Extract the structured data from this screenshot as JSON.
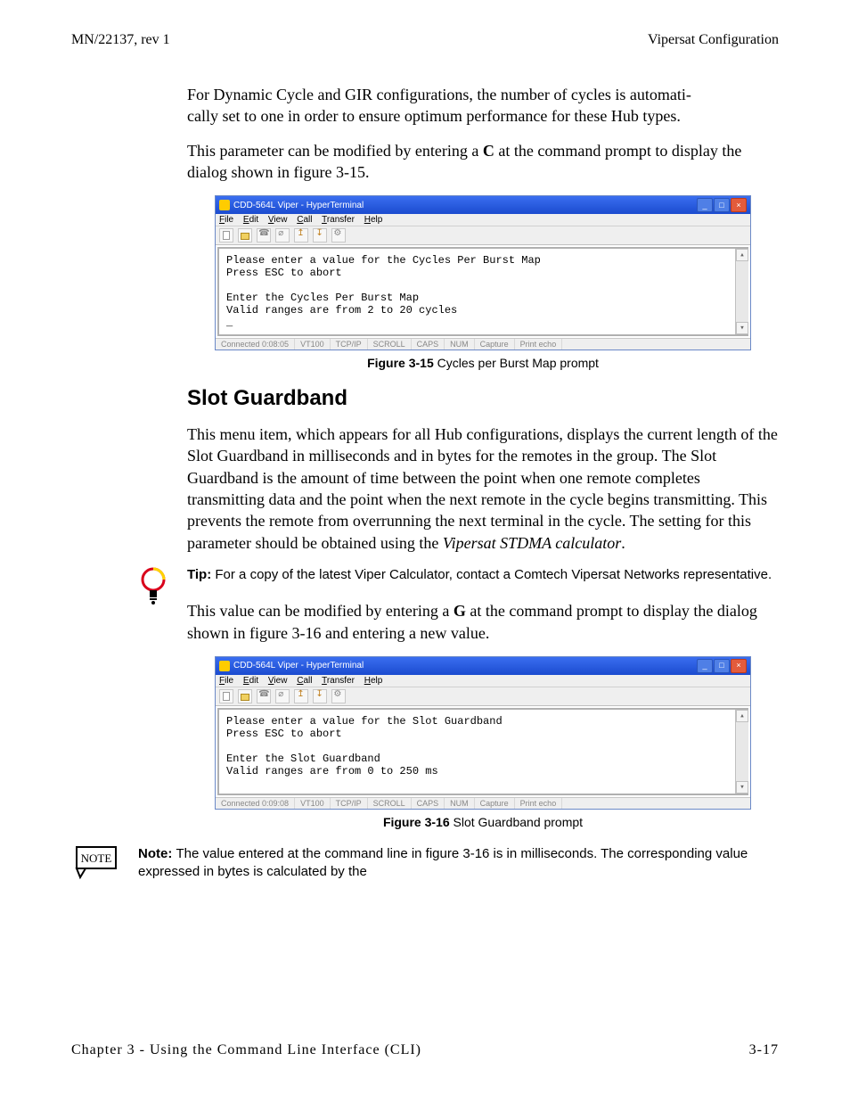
{
  "header": {
    "left": "MN/22137, rev 1",
    "right": "Vipersat Configuration"
  },
  "para1_a": "For Dynamic Cycle and GIR configurations, the number of cycles is automati-",
  "para1_b": "cally set to one in order to ensure optimum performance for these Hub types.",
  "para2_a": "This parameter can be modified by entering a ",
  "para2_bold": "C",
  "para2_b": " at the command prompt to display the dialog shown in figure 3-15.",
  "fig15": {
    "window_title": "CDD-564L Viper - HyperTerminal",
    "menu": {
      "file": "File",
      "edit": "Edit",
      "view": "View",
      "call": "Call",
      "transfer": "Transfer",
      "help": "Help"
    },
    "terminal_text": "Please enter a value for the Cycles Per Burst Map\nPress ESC to abort\n\nEnter the Cycles Per Burst Map\nValid ranges are from 2 to 20 cycles\n_",
    "status": {
      "connected": "Connected 0:08:05",
      "emu": "VT100",
      "proto": "TCP/IP",
      "scroll": "SCROLL",
      "caps": "CAPS",
      "num": "NUM",
      "capture": "Capture",
      "echo": "Print echo"
    },
    "caption_bold": "Figure 3-15",
    "caption_rest": "   Cycles per Burst Map prompt"
  },
  "h2": "Slot Guardband",
  "para3": "This menu item, which appears for all Hub configurations, displays the current length of the Slot Guardband in milliseconds and in bytes for the remotes in the group. The Slot Guardband is the amount of time between the point when one remote completes transmitting data and the point when the next remote in the cycle begins transmitting. This prevents the remote from overrunning the next terminal in the cycle. The setting for this parameter should be obtained using the ",
  "para3_ital": "Vipersat STDMA calculator",
  "para3_end": ".",
  "tip": {
    "label": "Tip:  ",
    "text": "For a copy of the latest Viper Calculator, contact a Comtech Vipersat Networks representative."
  },
  "para4_a": "This value can be modified by entering a ",
  "para4_bold": "G",
  "para4_b": " at the command prompt to display the dialog shown in figure 3-16 and entering a new value.",
  "fig16": {
    "window_title": "CDD-564L Viper - HyperTerminal",
    "menu": {
      "file": "File",
      "edit": "Edit",
      "view": "View",
      "call": "Call",
      "transfer": "Transfer",
      "help": "Help"
    },
    "terminal_text": "Please enter a value for the Slot Guardband\nPress ESC to abort\n\nEnter the Slot Guardband\nValid ranges are from 0 to 250 ms\n",
    "status": {
      "connected": "Connected 0:09:08",
      "emu": "VT100",
      "proto": "TCP/IP",
      "scroll": "SCROLL",
      "caps": "CAPS",
      "num": "NUM",
      "capture": "Capture",
      "echo": "Print echo"
    },
    "caption_bold": "Figure 3-16",
    "caption_rest": "   Slot Guardband prompt"
  },
  "note": {
    "label": "Note:  ",
    "text": "The value entered at the command line in figure 3-16 is in milliseconds. The corresponding value expressed in bytes is calculated by the"
  },
  "footer": {
    "left": "Chapter 3 - Using the Command Line Interface (CLI)",
    "right": "3-17"
  }
}
